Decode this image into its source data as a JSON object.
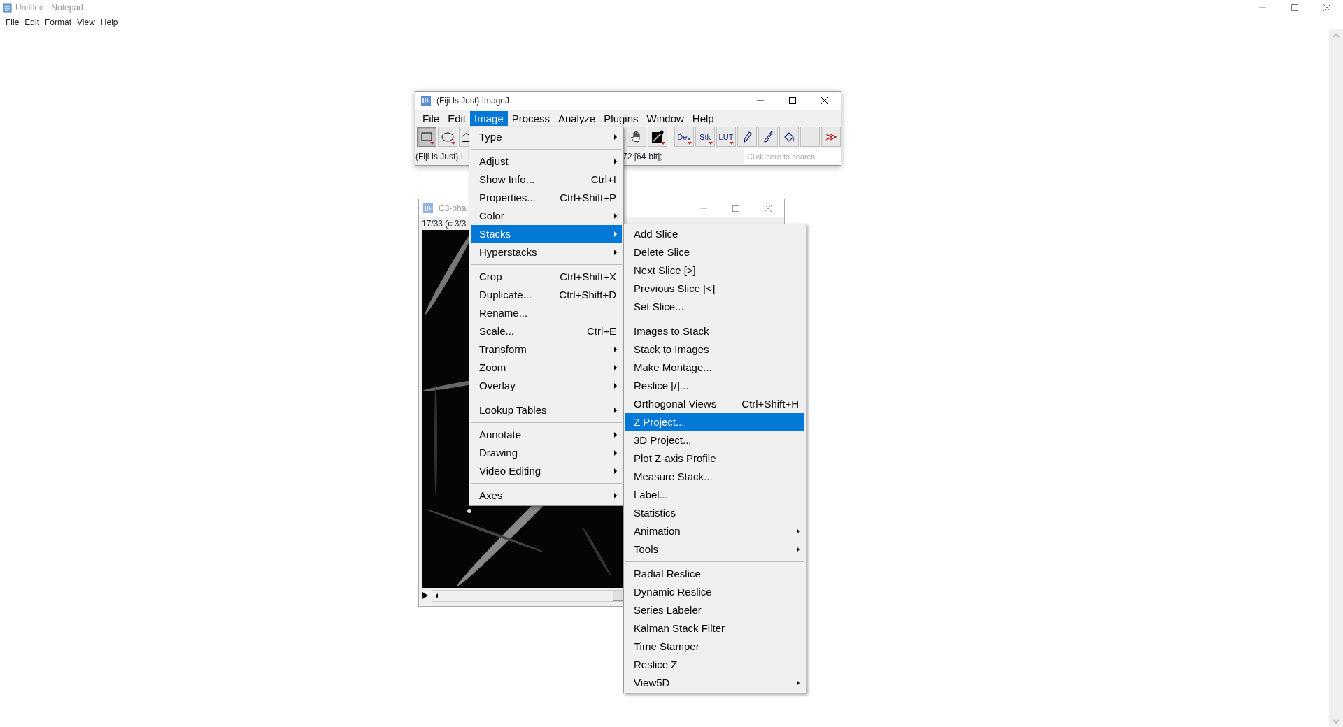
{
  "notepad": {
    "title": "Untitled - Notepad",
    "menu": [
      "File",
      "Edit",
      "Format",
      "View",
      "Help"
    ]
  },
  "fiji": {
    "title": "(Fiji Is Just) ImageJ",
    "menu": [
      {
        "label": "File",
        "selected": false
      },
      {
        "label": "Edit",
        "selected": false
      },
      {
        "label": "Image",
        "selected": true
      },
      {
        "label": "Process",
        "selected": false
      },
      {
        "label": "Analyze",
        "selected": false
      },
      {
        "label": "Plugins",
        "selected": false
      },
      {
        "label": "Window",
        "selected": false
      },
      {
        "label": "Help",
        "selected": false
      }
    ],
    "tools": [
      {
        "kind": "rectangle",
        "selected": true
      },
      {
        "kind": "oval",
        "selected": false
      },
      {
        "kind": "polygon",
        "selected": false
      },
      {
        "kind": "gap"
      },
      {
        "kind": "hand",
        "selected": false
      },
      {
        "kind": "dropper",
        "selected": false
      },
      {
        "kind": "space"
      },
      {
        "kind": "text",
        "label": "Dev",
        "selected": false
      },
      {
        "kind": "text",
        "label": "Stk",
        "selected": false
      },
      {
        "kind": "text",
        "label": "LUT",
        "selected": false
      },
      {
        "kind": "pencil",
        "selected": false
      },
      {
        "kind": "brush",
        "selected": false
      },
      {
        "kind": "fill",
        "selected": false
      },
      {
        "kind": "blank",
        "selected": false
      },
      {
        "kind": "more",
        "label": "≫",
        "selected": false
      }
    ],
    "status_left": "(Fiji Is Just) I",
    "status_right": "72 [64-bit];",
    "search": {
      "placeholder": "Click here to search"
    }
  },
  "image_window": {
    "title": "C3-phal",
    "info": "17/33 (c:3/3"
  },
  "image_menu": {
    "groups": [
      [
        {
          "label": "Type",
          "submenu": true,
          "selected": false
        }
      ],
      [
        {
          "label": "Adjust",
          "submenu": true,
          "selected": false
        },
        {
          "label": "Show Info...",
          "shortcut": "Ctrl+I",
          "submenu": false,
          "selected": false
        },
        {
          "label": "Properties...",
          "shortcut": "Ctrl+Shift+P",
          "submenu": false,
          "selected": false
        },
        {
          "label": "Color",
          "submenu": true,
          "selected": false
        },
        {
          "label": "Stacks",
          "submenu": true,
          "selected": true
        },
        {
          "label": "Hyperstacks",
          "submenu": true,
          "selected": false
        }
      ],
      [
        {
          "label": "Crop",
          "shortcut": "Ctrl+Shift+X",
          "submenu": false,
          "selected": false
        },
        {
          "label": "Duplicate...",
          "shortcut": "Ctrl+Shift+D",
          "submenu": false,
          "selected": false
        },
        {
          "label": "Rename...",
          "submenu": false,
          "selected": false
        },
        {
          "label": "Scale...",
          "shortcut": "Ctrl+E",
          "submenu": false,
          "selected": false
        },
        {
          "label": "Transform",
          "submenu": true,
          "selected": false
        },
        {
          "label": "Zoom",
          "submenu": true,
          "selected": false
        },
        {
          "label": "Overlay",
          "submenu": true,
          "selected": false
        }
      ],
      [
        {
          "label": "Lookup Tables",
          "submenu": true,
          "selected": false
        }
      ],
      [
        {
          "label": "Annotate",
          "submenu": true,
          "selected": false
        },
        {
          "label": "Drawing",
          "submenu": true,
          "selected": false
        },
        {
          "label": "Video Editing",
          "submenu": true,
          "selected": false
        }
      ],
      [
        {
          "label": "Axes",
          "submenu": true,
          "selected": false
        }
      ]
    ]
  },
  "stacks_menu": {
    "groups": [
      [
        {
          "label": "Add Slice",
          "submenu": false,
          "selected": false
        },
        {
          "label": "Delete Slice",
          "submenu": false,
          "selected": false
        },
        {
          "label": "Next Slice [>]",
          "submenu": false,
          "selected": false
        },
        {
          "label": "Previous Slice [<]",
          "submenu": false,
          "selected": false
        },
        {
          "label": "Set Slice...",
          "submenu": false,
          "selected": false
        }
      ],
      [
        {
          "label": "Images to Stack",
          "submenu": false,
          "selected": false
        },
        {
          "label": "Stack to Images",
          "submenu": false,
          "selected": false
        },
        {
          "label": "Make Montage...",
          "submenu": false,
          "selected": false
        },
        {
          "label": "Reslice [/]...",
          "submenu": false,
          "selected": false
        },
        {
          "label": "Orthogonal Views",
          "shortcut": "Ctrl+Shift+H",
          "submenu": false,
          "selected": false
        },
        {
          "label": "Z Project...",
          "submenu": false,
          "selected": true
        },
        {
          "label": "3D Project...",
          "submenu": false,
          "selected": false
        },
        {
          "label": "Plot Z-axis Profile",
          "submenu": false,
          "selected": false
        },
        {
          "label": "Measure Stack...",
          "submenu": false,
          "selected": false
        },
        {
          "label": "Label...",
          "submenu": false,
          "selected": false
        },
        {
          "label": "Statistics",
          "submenu": false,
          "selected": false
        },
        {
          "label": "Animation",
          "submenu": true,
          "selected": false
        },
        {
          "label": "Tools",
          "submenu": true,
          "selected": false
        }
      ],
      [
        {
          "label": "Radial Reslice",
          "submenu": false,
          "selected": false
        },
        {
          "label": "Dynamic Reslice",
          "submenu": false,
          "selected": false
        },
        {
          "label": "Series Labeler",
          "submenu": false,
          "selected": false
        },
        {
          "label": "Kalman Stack Filter",
          "submenu": false,
          "selected": false
        },
        {
          "label": "Time Stamper",
          "submenu": false,
          "selected": false
        },
        {
          "label": "Reslice Z",
          "submenu": false,
          "selected": false
        },
        {
          "label": "View5D",
          "submenu": true,
          "selected": false
        }
      ]
    ]
  }
}
